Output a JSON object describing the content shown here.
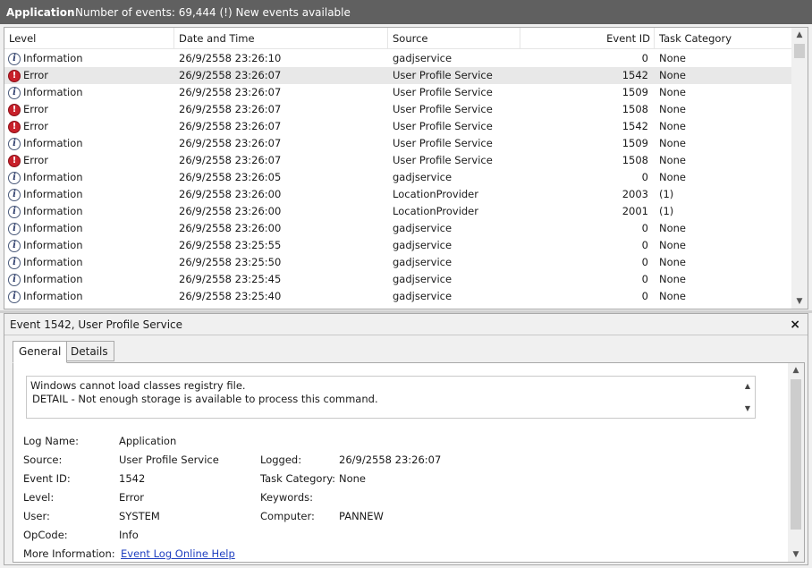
{
  "titlebar": {
    "app": "Application",
    "count": "Number of events: 69,444 (!) New events available"
  },
  "columns": {
    "level": "Level",
    "date": "Date and Time",
    "source": "Source",
    "event_id": "Event ID",
    "category": "Task Category"
  },
  "events": [
    {
      "level": "Information",
      "type": "info",
      "date": "26/9/2558 23:26:10",
      "source": "gadjservice",
      "event_id": "0",
      "category": "None"
    },
    {
      "level": "Error",
      "type": "error",
      "date": "26/9/2558 23:26:07",
      "source": "User Profile Service",
      "event_id": "1542",
      "category": "None"
    },
    {
      "level": "Information",
      "type": "info",
      "date": "26/9/2558 23:26:07",
      "source": "User Profile Service",
      "event_id": "1509",
      "category": "None"
    },
    {
      "level": "Error",
      "type": "error",
      "date": "26/9/2558 23:26:07",
      "source": "User Profile Service",
      "event_id": "1508",
      "category": "None"
    },
    {
      "level": "Error",
      "type": "error",
      "date": "26/9/2558 23:26:07",
      "source": "User Profile Service",
      "event_id": "1542",
      "category": "None"
    },
    {
      "level": "Information",
      "type": "info",
      "date": "26/9/2558 23:26:07",
      "source": "User Profile Service",
      "event_id": "1509",
      "category": "None"
    },
    {
      "level": "Error",
      "type": "error",
      "date": "26/9/2558 23:26:07",
      "source": "User Profile Service",
      "event_id": "1508",
      "category": "None"
    },
    {
      "level": "Information",
      "type": "info",
      "date": "26/9/2558 23:26:05",
      "source": "gadjservice",
      "event_id": "0",
      "category": "None"
    },
    {
      "level": "Information",
      "type": "info",
      "date": "26/9/2558 23:26:00",
      "source": "LocationProvider",
      "event_id": "2003",
      "category": "(1)"
    },
    {
      "level": "Information",
      "type": "info",
      "date": "26/9/2558 23:26:00",
      "source": "LocationProvider",
      "event_id": "2001",
      "category": "(1)"
    },
    {
      "level": "Information",
      "type": "info",
      "date": "26/9/2558 23:26:00",
      "source": "gadjservice",
      "event_id": "0",
      "category": "None"
    },
    {
      "level": "Information",
      "type": "info",
      "date": "26/9/2558 23:25:55",
      "source": "gadjservice",
      "event_id": "0",
      "category": "None"
    },
    {
      "level": "Information",
      "type": "info",
      "date": "26/9/2558 23:25:50",
      "source": "gadjservice",
      "event_id": "0",
      "category": "None"
    },
    {
      "level": "Information",
      "type": "info",
      "date": "26/9/2558 23:25:45",
      "source": "gadjservice",
      "event_id": "0",
      "category": "None"
    },
    {
      "level": "Information",
      "type": "info",
      "date": "26/9/2558 23:25:40",
      "source": "gadjservice",
      "event_id": "0",
      "category": "None"
    }
  ],
  "selected_index": 1,
  "detail": {
    "title": "Event 1542, User Profile Service",
    "close": "×",
    "tabs": [
      "General",
      "Details"
    ],
    "active_tab": 0,
    "message_line1": "Windows cannot load classes registry file.",
    "message_line2": "DETAIL - Not enough storage is available to process this command.",
    "fields": {
      "log_name_label": "Log Name:",
      "log_name": "Application",
      "source_label": "Source:",
      "source": "User Profile Service",
      "logged_label": "Logged:",
      "logged": "26/9/2558 23:26:07",
      "event_id_label": "Event ID:",
      "event_id": "1542",
      "task_category_label": "Task Category:",
      "task_category": "None",
      "level_label": "Level:",
      "level": "Error",
      "keywords_label": "Keywords:",
      "keywords": "",
      "user_label": "User:",
      "user": "SYSTEM",
      "computer_label": "Computer:",
      "computer": "PANNEW",
      "opcode_label": "OpCode:",
      "opcode": "Info",
      "more_info_label": "More Information:",
      "more_info_link": "Event Log Online Help"
    }
  }
}
